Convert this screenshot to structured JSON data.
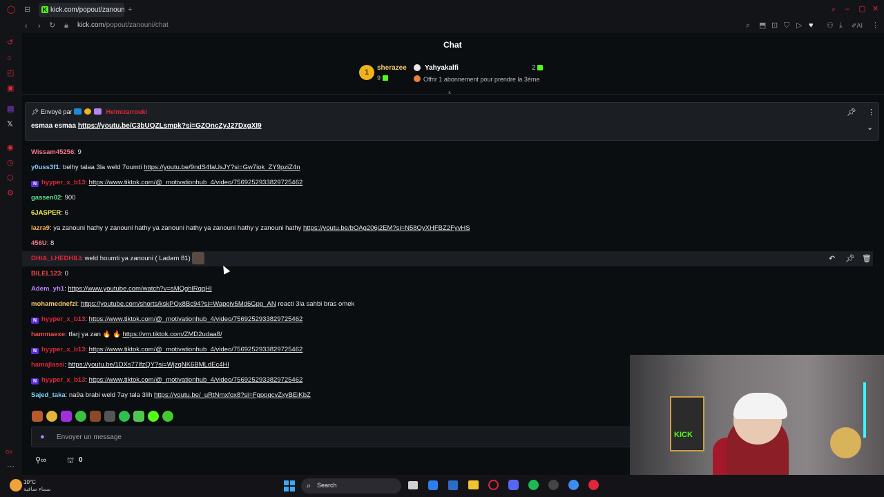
{
  "browser": {
    "tab_title": "kick.com/popout/zanouni/",
    "address_host": "kick.com",
    "address_path": "/popout/zanouni/chat"
  },
  "chat": {
    "title": "Chat",
    "leaderboard": {
      "first": {
        "rank": "1",
        "name": "sherazee",
        "count": "9"
      },
      "second": {
        "name": "Yahyakalfi",
        "count": "2",
        "hint": "Offrir 1 abonnement pour prendre la 3ème"
      }
    },
    "pinned": {
      "sent_by_label": "Envoyé par",
      "sender": "Helmizarrouki",
      "text_prefix": "esmaa esmaa ",
      "link": "https://youtu.be/C3bUQZLsmpk?si=GZOncZyJ27DxgXI9"
    },
    "messages": [
      {
        "user": "Wissam45256",
        "color": "#f2778a",
        "text": ": 9",
        "link": ""
      },
      {
        "user": "y0uss3f1",
        "color": "#89c9ff",
        "text": ": belhy talaa 3la weld 7oumti ",
        "link": "https://youtu.be/9ndS4faUsJY?si=Gw7iok_ZY9pziZ4n"
      },
      {
        "user": "hyyper_x_b13",
        "color": "#e0263a",
        "text": ": ",
        "link": "https://www.tiktok.com/@_motivationhub_4/video/7569252933829725462",
        "badge": true
      },
      {
        "user": "gassen02",
        "color": "#5ee08f",
        "text": ": 900",
        "link": ""
      },
      {
        "user": "6JASPER",
        "color": "#f3ec4f",
        "text": ": 6",
        "link": ""
      },
      {
        "user": "lazra9",
        "color": "#f5b347",
        "text": ": ya zanouni hathy y zanouni hathy ya zanouni hathy ya zanouni hathy y zanouni hathy ",
        "link": "https://youtu.be/bOAg206j2EM?si=N58QyXHFBZ2FyvHS"
      },
      {
        "user": "456U",
        "color": "#f2778a",
        "text": ": 8",
        "link": ""
      },
      {
        "user": "DHIA_LHEDHILI",
        "color": "#e0263a",
        "text": ": weld houmti ya zanouni ( Ladam 81)",
        "link": ""
      },
      {
        "user": "BILEL123",
        "color": "#f04a4a",
        "text": ": 0",
        "link": ""
      },
      {
        "user": "Adem_yh1",
        "color": "#b784f5",
        "text": ": ",
        "link": "https://www.youtube.com/watch?v=sMQghlRqqHI"
      },
      {
        "user": "mohamednefzi",
        "color": "#f3c86c",
        "text": ": ",
        "link": "https://youtube.com/shorts/kskPQx8Bc94?si=Wapgiv5Md6Gpp_AN",
        "after": " reacti 3la sahbi bras omek"
      },
      {
        "user": "hyyper_x_b13",
        "color": "#e0263a",
        "text": ": ",
        "link": "https://www.tiktok.com/@_motivationhub_4/video/7569252933829725462",
        "badge": true
      },
      {
        "user": "hammaexe",
        "color": "#f04a4a",
        "text": ": tfarj ya zan 🔥 🔥 ",
        "link": "https://vm.tiktok.com/ZMD2udaa8/"
      },
      {
        "user": "hyyper_x_b13",
        "color": "#e0263a",
        "text": ": ",
        "link": "https://www.tiktok.com/@_motivationhub_4/video/7569252933829725462",
        "badge": true
      },
      {
        "user": "hamajlassi",
        "color": "#e0263a",
        "text": ": ",
        "link": "https://youtu.be/1DXs77IfzQY?si=WjzqNK6BMLdEc4Hl"
      },
      {
        "user": "hyyper_x_b13",
        "color": "#e0263a",
        "text": ": ",
        "link": "https://www.tiktok.com/@_motivationhub_4/video/7569252933829725462",
        "badge": true
      },
      {
        "user": "Sajed_taka",
        "color": "#7ad3f7",
        "text": ": na9a brabi weld 7ay tala 3lih ",
        "link": "https://youtu.be/_uRtNmxfox8?si=FgppqcvZxyBEiKbZ"
      }
    ],
    "composer_placeholder": "Envoyer un message",
    "points": "0",
    "badge_letter": "N"
  },
  "taskbar": {
    "weather_temp": "10°C",
    "weather_desc": "سماء صافية",
    "search_label": "Search"
  },
  "colors": {
    "kick_green": "#53fc18",
    "accent_red": "#e0263a",
    "background": "#0b0e11"
  }
}
